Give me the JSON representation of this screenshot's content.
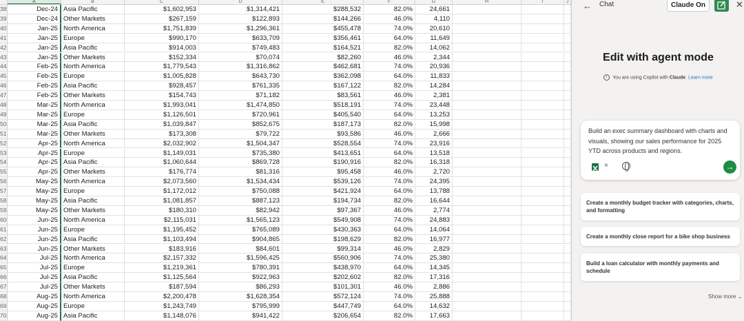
{
  "sheet": {
    "columns": [
      "A",
      "B",
      "C",
      "D",
      "E",
      "F",
      "G",
      "H",
      "I",
      "J"
    ],
    "rows": [
      {
        "n": "38",
        "date": "Dec-24",
        "region": "Asia Pacific",
        "c": "$1,602,953",
        "d": "$1,314,421",
        "e": "$288,532",
        "f": "82.0%",
        "g": "24,661"
      },
      {
        "n": "39",
        "date": "Dec-24",
        "region": "Other Markets",
        "c": "$267,159",
        "d": "$122,893",
        "e": "$144,266",
        "f": "46.0%",
        "g": "4,110"
      },
      {
        "n": "40",
        "date": "Jan-25",
        "region": "North America",
        "c": "$1,751,839",
        "d": "$1,296,361",
        "e": "$455,478",
        "f": "74.0%",
        "g": "20,610"
      },
      {
        "n": "41",
        "date": "Jan-25",
        "region": "Europe",
        "c": "$990,170",
        "d": "$633,709",
        "e": "$356,461",
        "f": "64.0%",
        "g": "11,649"
      },
      {
        "n": "42",
        "date": "Jan-25",
        "region": "Asia Pacific",
        "c": "$914,003",
        "d": "$749,483",
        "e": "$164,521",
        "f": "82.0%",
        "g": "14,062"
      },
      {
        "n": "43",
        "date": "Jan-25",
        "region": "Other Markets",
        "c": "$152,334",
        "d": "$70,074",
        "e": "$82,260",
        "f": "46.0%",
        "g": "2,344"
      },
      {
        "n": "44",
        "date": "Feb-25",
        "region": "North America",
        "c": "$1,779,543",
        "d": "$1,316,862",
        "e": "$462,681",
        "f": "74.0%",
        "g": "20,936"
      },
      {
        "n": "45",
        "date": "Feb-25",
        "region": "Europe",
        "c": "$1,005,828",
        "d": "$643,730",
        "e": "$362,098",
        "f": "64.0%",
        "g": "11,833"
      },
      {
        "n": "46",
        "date": "Feb-25",
        "region": "Asia Pacific",
        "c": "$928,457",
        "d": "$761,335",
        "e": "$167,122",
        "f": "82.0%",
        "g": "14,284"
      },
      {
        "n": "47",
        "date": "Feb-25",
        "region": "Other Markets",
        "c": "$154,743",
        "d": "$71,182",
        "e": "$83,561",
        "f": "46.0%",
        "g": "2,381"
      },
      {
        "n": "48",
        "date": "Mar-25",
        "region": "North America",
        "c": "$1,993,041",
        "d": "$1,474,850",
        "e": "$518,191",
        "f": "74.0%",
        "g": "23,448"
      },
      {
        "n": "49",
        "date": "Mar-25",
        "region": "Europe",
        "c": "$1,126,501",
        "d": "$720,961",
        "e": "$405,540",
        "f": "64.0%",
        "g": "13,253"
      },
      {
        "n": "50",
        "date": "Mar-25",
        "region": "Asia Pacific",
        "c": "$1,039,847",
        "d": "$852,675",
        "e": "$187,173",
        "f": "82.0%",
        "g": "15,998"
      },
      {
        "n": "51",
        "date": "Mar-25",
        "region": "Other Markets",
        "c": "$173,308",
        "d": "$79,722",
        "e": "$93,586",
        "f": "46.0%",
        "g": "2,666"
      },
      {
        "n": "52",
        "date": "Apr-25",
        "region": "North America",
        "c": "$2,032,902",
        "d": "$1,504,347",
        "e": "$528,554",
        "f": "74.0%",
        "g": "23,916"
      },
      {
        "n": "53",
        "date": "Apr-25",
        "region": "Europe",
        "c": "$1,149,031",
        "d": "$735,380",
        "e": "$413,651",
        "f": "64.0%",
        "g": "13,518"
      },
      {
        "n": "54",
        "date": "Apr-25",
        "region": "Asia Pacific",
        "c": "$1,060,644",
        "d": "$869,728",
        "e": "$190,916",
        "f": "82.0%",
        "g": "16,318"
      },
      {
        "n": "55",
        "date": "Apr-25",
        "region": "Other Markets",
        "c": "$176,774",
        "d": "$81,316",
        "e": "$95,458",
        "f": "46.0%",
        "g": "2,720"
      },
      {
        "n": "56",
        "date": "May-25",
        "region": "North America",
        "c": "$2,073,560",
        "d": "$1,534,434",
        "e": "$539,126",
        "f": "74.0%",
        "g": "24,395"
      },
      {
        "n": "57",
        "date": "May-25",
        "region": "Europe",
        "c": "$1,172,012",
        "d": "$750,088",
        "e": "$421,924",
        "f": "64.0%",
        "g": "13,788"
      },
      {
        "n": "58",
        "date": "May-25",
        "region": "Asia Pacific",
        "c": "$1,081,857",
        "d": "$887,123",
        "e": "$194,734",
        "f": "82.0%",
        "g": "16,644"
      },
      {
        "n": "59",
        "date": "May-25",
        "region": "Other Markets",
        "c": "$180,310",
        "d": "$82,942",
        "e": "$97,367",
        "f": "46.0%",
        "g": "2,774"
      },
      {
        "n": "60",
        "date": "Jun-25",
        "region": "North America",
        "c": "$2,115,031",
        "d": "$1,565,123",
        "e": "$549,908",
        "f": "74.0%",
        "g": "24,883"
      },
      {
        "n": "61",
        "date": "Jun-25",
        "region": "Europe",
        "c": "$1,195,452",
        "d": "$765,089",
        "e": "$430,363",
        "f": "64.0%",
        "g": "14,064"
      },
      {
        "n": "62",
        "date": "Jun-25",
        "region": "Asia Pacific",
        "c": "$1,103,494",
        "d": "$904,865",
        "e": "$198,629",
        "f": "82.0%",
        "g": "16,977"
      },
      {
        "n": "63",
        "date": "Jun-25",
        "region": "Other Markets",
        "c": "$183,916",
        "d": "$84,601",
        "e": "$99,314",
        "f": "46.0%",
        "g": "2,829"
      },
      {
        "n": "64",
        "date": "Jul-25",
        "region": "North America",
        "c": "$2,157,332",
        "d": "$1,596,425",
        "e": "$560,906",
        "f": "74.0%",
        "g": "25,380"
      },
      {
        "n": "65",
        "date": "Jul-25",
        "region": "Europe",
        "c": "$1,219,361",
        "d": "$780,391",
        "e": "$438,970",
        "f": "64.0%",
        "g": "14,345"
      },
      {
        "n": "66",
        "date": "Jul-25",
        "region": "Asia Pacific",
        "c": "$1,125,564",
        "d": "$922,963",
        "e": "$202,602",
        "f": "82.0%",
        "g": "17,316"
      },
      {
        "n": "67",
        "date": "Jul-25",
        "region": "Other Markets",
        "c": "$187,594",
        "d": "$86,293",
        "e": "$101,301",
        "f": "46.0%",
        "g": "2,886"
      },
      {
        "n": "68",
        "date": "Aug-25",
        "region": "North America",
        "c": "$2,200,478",
        "d": "$1,628,354",
        "e": "$572,124",
        "f": "74.0%",
        "g": "25,888"
      },
      {
        "n": "69",
        "date": "Aug-25",
        "region": "Europe",
        "c": "$1,243,749",
        "d": "$795,999",
        "e": "$447,749",
        "f": "64.0%",
        "g": "14,632"
      },
      {
        "n": "70",
        "date": "Aug-25",
        "region": "Asia Pacific",
        "c": "$1,148,076",
        "d": "$941,422",
        "e": "$206,654",
        "f": "82.0%",
        "g": "17,663"
      }
    ]
  },
  "pane": {
    "title": "Chat",
    "claude_on": "Claude On",
    "hero_title": "Edit with agent mode",
    "hero_sub_prefix": "You are using Copilot with ",
    "hero_sub_bold": "Claude",
    "hero_sub_suffix": ". ",
    "learn_more": "Learn more",
    "prompt": "Build an exec summary dashboard with charts and visuals, showing our sales performance for 2025 YTD across products and regions.",
    "suggestions": [
      "Create a monthly budget tracker with categories, charts, and formatting",
      "Create a monthly close report for a bike shop business",
      "Build a loan calculator with monthly payments and schedule"
    ],
    "show_more": "Show more"
  },
  "colors": {
    "excel_green": "#1e7145",
    "send_green": "#1e8c45",
    "pane_bg": "#f3f2f1",
    "link_blue": "#1e6fbf"
  },
  "icons": [
    "back-arrow-icon",
    "new-chat-icon",
    "close-icon",
    "info-icon",
    "excel-file-icon",
    "remove-icon",
    "globe-icon",
    "send-arrow-icon",
    "chevron-down-icon"
  ]
}
